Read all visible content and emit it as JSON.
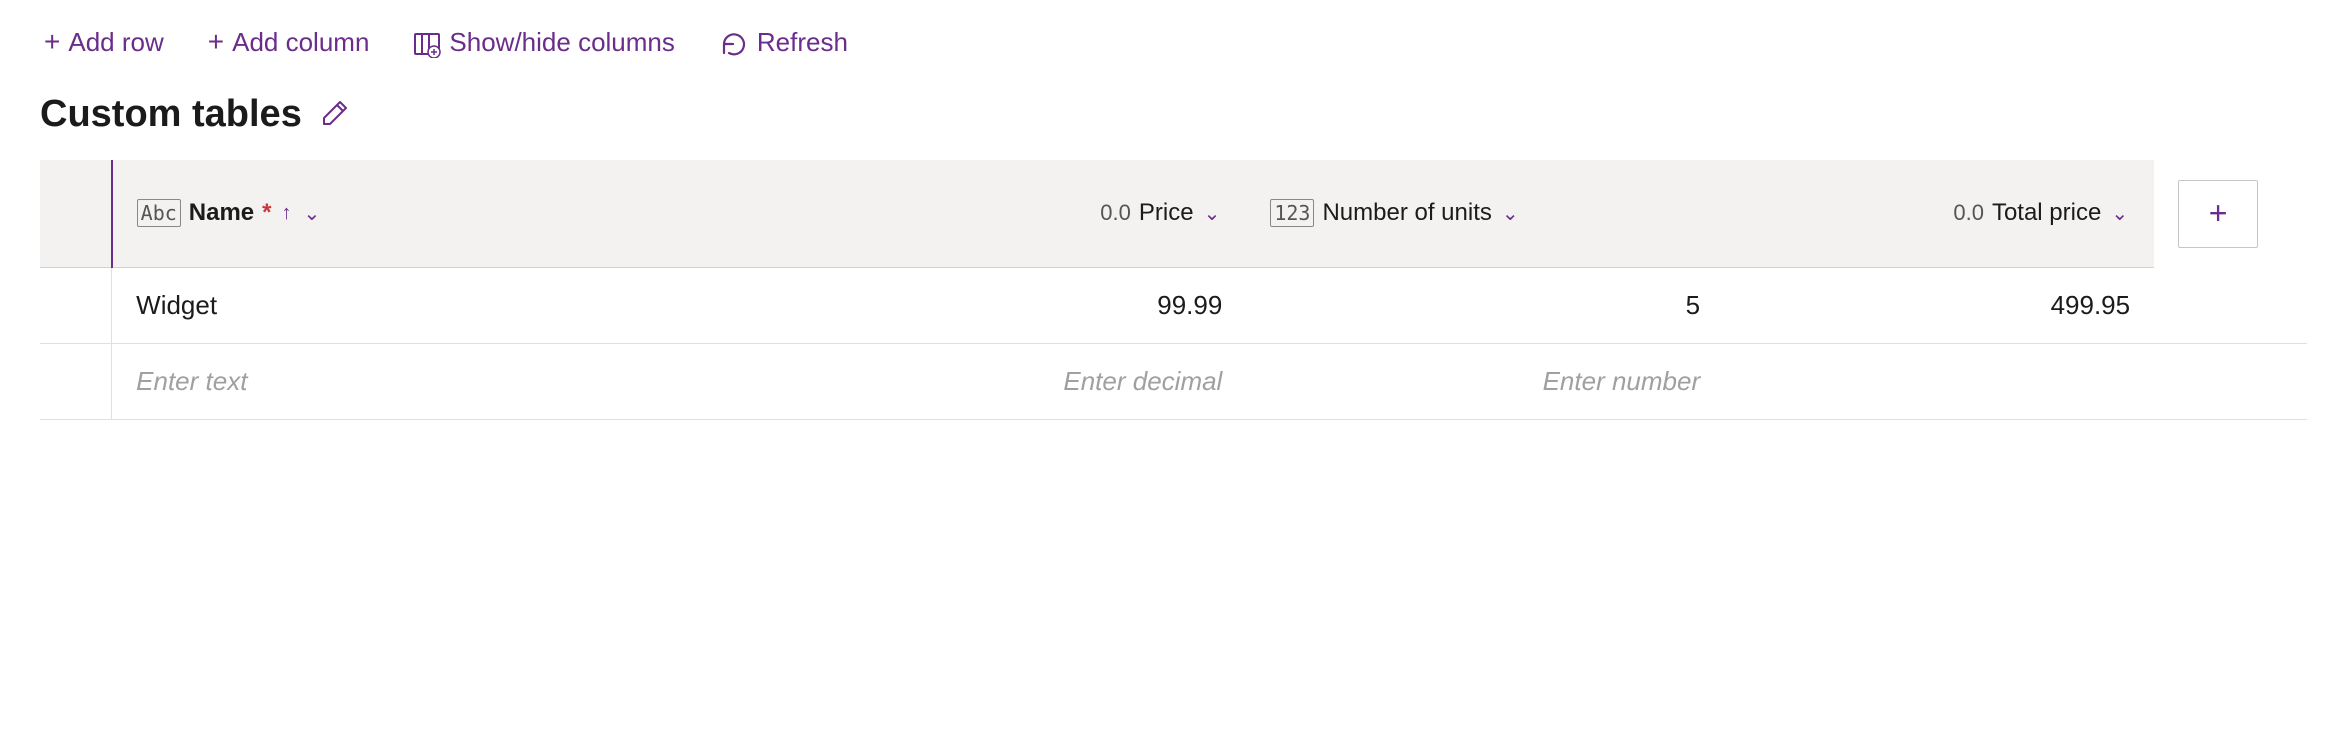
{
  "toolbar": {
    "add_row_label": "Add row",
    "add_column_label": "Add column",
    "show_hide_columns_label": "Show/hide columns",
    "refresh_label": "Refresh"
  },
  "page": {
    "title": "Custom tables",
    "edit_icon": "✏"
  },
  "table": {
    "columns": [
      {
        "id": "name",
        "icon": "Abc",
        "label": "Name",
        "required": true,
        "sortable": true,
        "type": "text",
        "align": "left"
      },
      {
        "id": "price",
        "icon": "0.0",
        "label": "Price",
        "required": false,
        "sortable": true,
        "type": "decimal",
        "align": "right"
      },
      {
        "id": "units",
        "icon": "123",
        "label": "Number of units",
        "required": false,
        "sortable": true,
        "type": "number",
        "align": "left"
      },
      {
        "id": "total",
        "icon": "0.0",
        "label": "Total price",
        "required": false,
        "sortable": true,
        "type": "decimal",
        "align": "right"
      }
    ],
    "rows": [
      {
        "name": "Widget",
        "price": "99.99",
        "units": "5",
        "total": "499.95"
      }
    ],
    "new_row": {
      "name_placeholder": "Enter text",
      "price_placeholder": "Enter decimal",
      "units_placeholder": "Enter number",
      "total_placeholder": ""
    },
    "add_column_icon": "+"
  },
  "icons": {
    "plus": "+",
    "show_hide": "⊞",
    "refresh": "↺",
    "edit": "✏",
    "sort_asc": "↑",
    "sort_chevron": "⌄"
  }
}
